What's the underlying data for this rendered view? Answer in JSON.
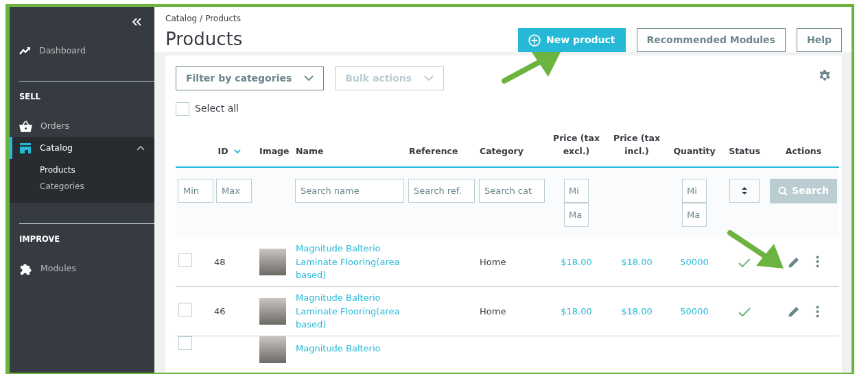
{
  "sidebar": {
    "top_items": [
      {
        "label": "Dashboard",
        "selected": false
      }
    ],
    "sections": [
      {
        "title": "SELL",
        "items": [
          {
            "label": "Orders",
            "selected": false
          },
          {
            "label": "Catalog",
            "selected": true,
            "expanded": true,
            "children": [
              {
                "label": "Products",
                "selected": true
              },
              {
                "label": "Categories",
                "selected": false
              }
            ]
          }
        ]
      },
      {
        "title": "IMPROVE",
        "items": [
          {
            "label": "Modules",
            "selected": false
          }
        ]
      }
    ]
  },
  "breadcrumb": {
    "items": [
      "Catalog",
      "Products"
    ],
    "separator": "/"
  },
  "page_title": "Products",
  "header_buttons": [
    {
      "label": "New product",
      "kind": "primary"
    },
    {
      "label": "Recommended Modules",
      "kind": "outline"
    },
    {
      "label": "Help",
      "kind": "outline"
    }
  ],
  "toolbar": {
    "dropdowns": [
      {
        "label": "Filter by categories",
        "disabled": false
      },
      {
        "label": "Bulk actions",
        "disabled": true
      }
    ],
    "select_all": {
      "label": "Select all",
      "checked": false
    }
  },
  "table": {
    "columns": [
      {
        "label": "ID",
        "sorted": true
      },
      {
        "label": "Image",
        "sorted": false
      },
      {
        "label": "Name",
        "sorted": false
      },
      {
        "label": "Reference",
        "sorted": false
      },
      {
        "label": "Category",
        "sorted": false
      },
      {
        "label": "Price (tax excl.)",
        "sorted": false
      },
      {
        "label": "Price (tax incl.)",
        "sorted": false
      },
      {
        "label": "Quantity",
        "sorted": false
      },
      {
        "label": "Status",
        "sorted": false
      },
      {
        "label": "Actions",
        "sorted": false
      }
    ],
    "filters": {
      "id": [
        {
          "placeholder": "Min"
        },
        {
          "placeholder": "Max"
        }
      ],
      "name": {
        "placeholder": "Search name"
      },
      "reference": {
        "placeholder": "Search ref."
      },
      "category": {
        "placeholder": "Search cat"
      },
      "price_excl": [
        {
          "placeholder": "Mi"
        },
        {
          "placeholder": "Ma"
        }
      ],
      "quantity": [
        {
          "placeholder": "Mi"
        },
        {
          "placeholder": "Ma"
        }
      ],
      "search_button": "Search"
    },
    "rows": [
      {
        "checked": false,
        "id": "48",
        "name": "Magnitude Balterio Laminate Flooring(area based)",
        "category": "Home",
        "price_excl": "$18.00",
        "price_incl": "$18.00",
        "quantity": "50000",
        "enabled": true
      },
      {
        "checked": false,
        "id": "46",
        "name": "Magnitude Balterio Laminate Flooring(area based)",
        "category": "Home",
        "price_excl": "$18.00",
        "price_incl": "$18.00",
        "quantity": "50000",
        "enabled": true
      },
      {
        "checked": false,
        "name": "Magnitude Balterio"
      }
    ]
  }
}
